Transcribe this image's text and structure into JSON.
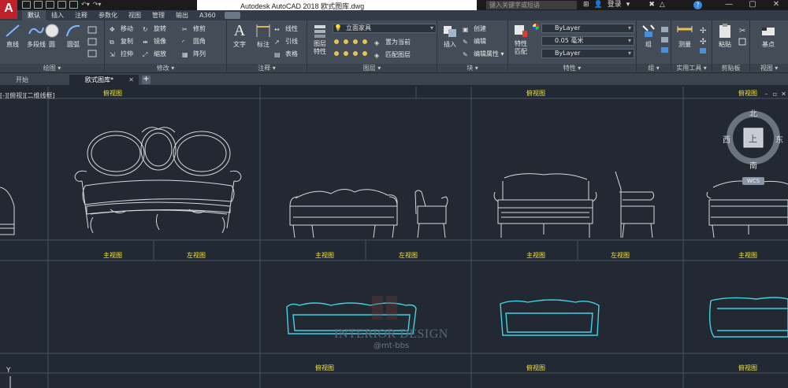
{
  "app": {
    "logo_letter": "A",
    "title": "Autodesk AutoCAD 2018    欧式图库.dwg",
    "search_placeholder": "键入关键字或短语",
    "login_label": "登录",
    "help_label": "?",
    "window_buttons": [
      "—",
      "▢",
      "✕"
    ]
  },
  "ribbon_tabs": [
    "默认",
    "插入",
    "注释",
    "参数化",
    "视图",
    "管理",
    "输出",
    "A360"
  ],
  "ribbon": {
    "draw": {
      "footer": "绘图 ▾",
      "big": [
        "直线",
        "多段线",
        "圆",
        "圆弧"
      ]
    },
    "modify": {
      "footer": "修改 ▾",
      "small": [
        "移动",
        "旋转",
        "修剪",
        "复制",
        "镜像",
        "圆角",
        "拉伸",
        "缩放",
        "阵列"
      ]
    },
    "annotation": {
      "footer": "注释 ▾",
      "big": [
        "文字",
        "标注"
      ],
      "small": [
        "线性",
        "引线",
        "表格"
      ]
    },
    "layers": {
      "footer": "图层 ▾",
      "big": [
        "图层\n特性"
      ],
      "layer_dropdown": "立面家具",
      "small": [
        "置为当前",
        "匹配图层"
      ]
    },
    "block": {
      "footer": "块 ▾",
      "big": [
        "插入"
      ],
      "small": [
        "创建",
        "编辑",
        "编辑属性 ▾"
      ]
    },
    "properties": {
      "footer": "特性 ▾",
      "big": [
        "特性\n匹配"
      ],
      "color_value": "ByLayer",
      "lineweight_value": "0.05 毫米",
      "linetype_value": "ByLayer"
    },
    "group": {
      "footer": "组 ▾",
      "big": [
        "组"
      ]
    },
    "utilities": {
      "footer": "实用工具 ▾",
      "big": [
        "测量"
      ]
    },
    "clipboard": {
      "footer": "剪贴板",
      "big": [
        "粘贴"
      ]
    },
    "view": {
      "footer": "视图 ▾",
      "big": [
        "基点"
      ]
    }
  },
  "file_tabs": [
    {
      "label": "开始",
      "active": false
    },
    {
      "label": "欧式图库*",
      "active": true
    }
  ],
  "viewport": {
    "label": "[-][俯视][二维线框]",
    "controls": [
      "–",
      "▫",
      "✕"
    ]
  },
  "view_labels": {
    "top": "俯视图",
    "front": "主视图",
    "left": "左视图"
  },
  "viewcube": {
    "north": "北",
    "south": "南",
    "east": "东",
    "west": "西",
    "face": "上",
    "wcs": "WCS"
  },
  "watermark": {
    "text": "INTERIOR DESIGN",
    "sub": "@mt-bbs"
  },
  "ucs_label": "Y",
  "colors": {
    "canvas": "#222933",
    "ribbon": "#434c57",
    "label_yellow": "#f2e33a",
    "cyan_drawing": "#3fd3e6",
    "linework": "#d8d8d8",
    "autocad_red": "#c0202a"
  }
}
